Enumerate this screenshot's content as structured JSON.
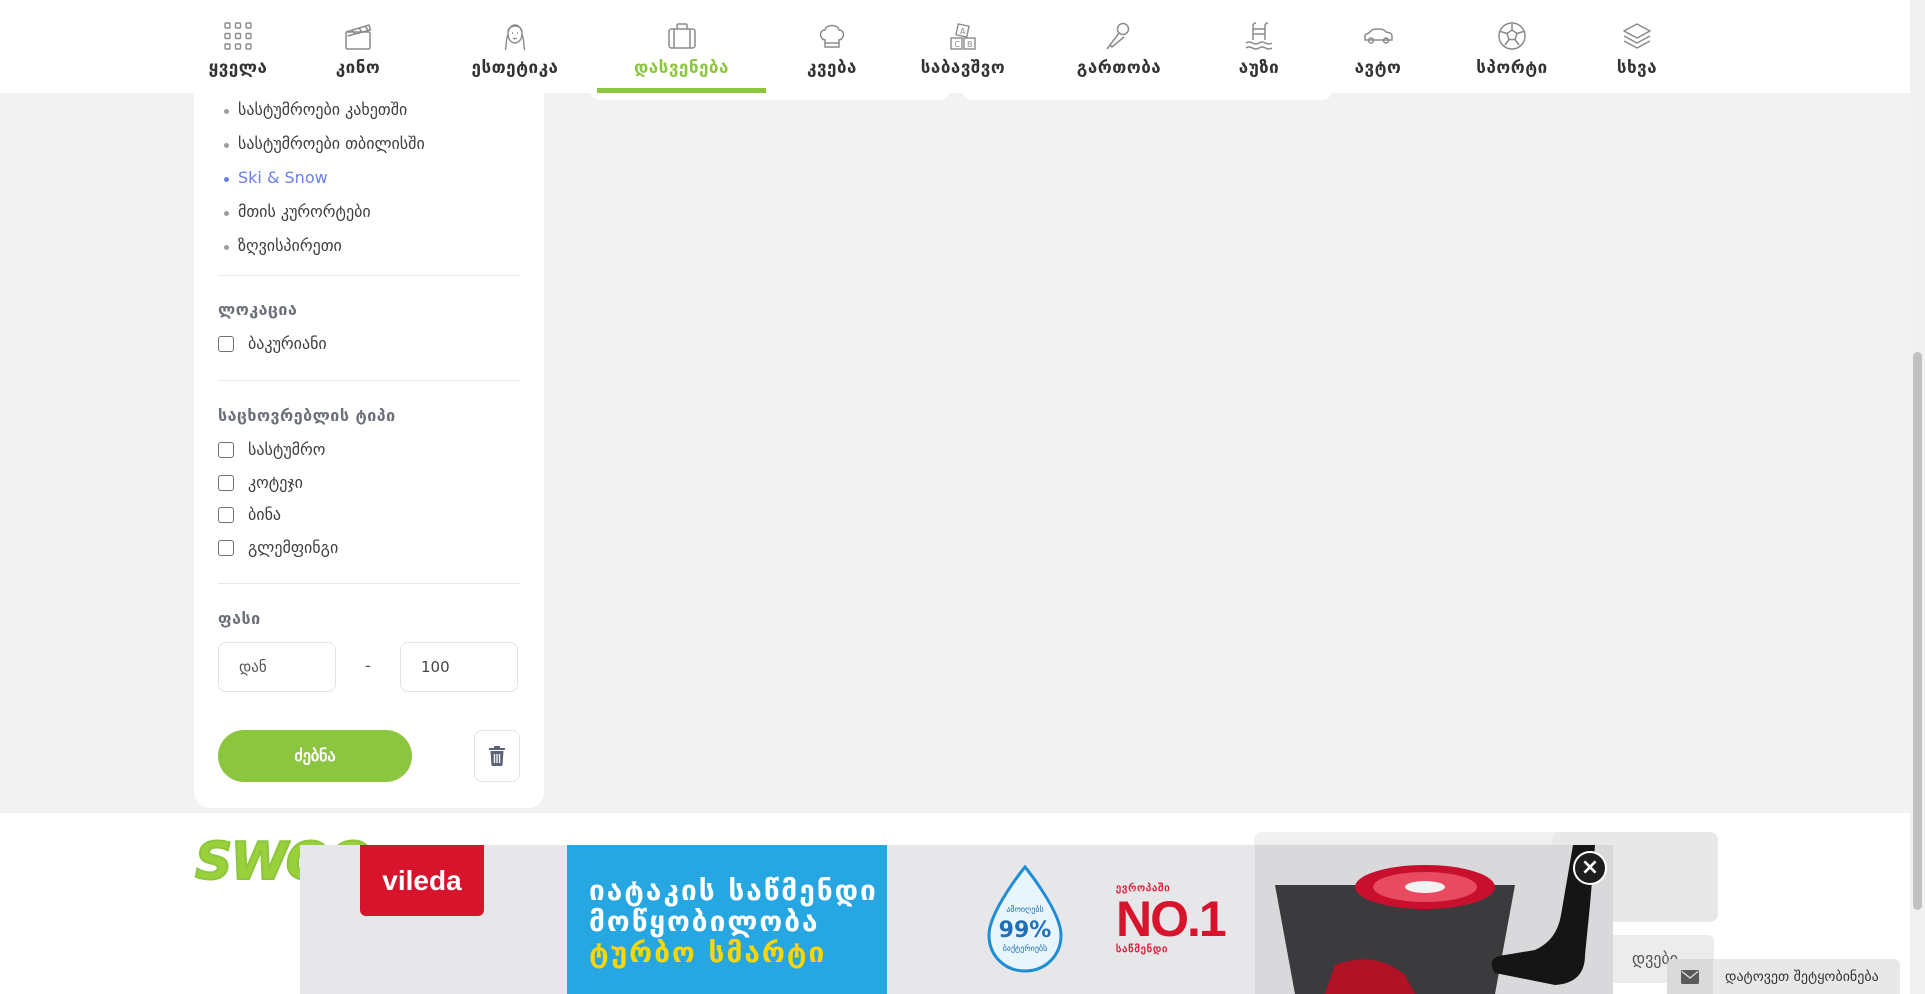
{
  "nav": {
    "categories": [
      {
        "label": "ყველა",
        "icon": "grid-icon"
      },
      {
        "label": "კინო",
        "icon": "clapperboard-icon"
      },
      {
        "label": "ესთეტიკა",
        "icon": "woman-face-icon"
      },
      {
        "label": "დასვენება",
        "icon": "suitcase-icon"
      },
      {
        "label": "კვება",
        "icon": "chef-hat-icon"
      },
      {
        "label": "საბავშვო",
        "icon": "toy-blocks-icon"
      },
      {
        "label": "გართობა",
        "icon": "microphone-icon"
      },
      {
        "label": "აუზი",
        "icon": "pool-ladder-icon"
      },
      {
        "label": "ავტო",
        "icon": "car-icon"
      },
      {
        "label": "სპორტი",
        "icon": "football-icon"
      },
      {
        "label": "სხვა",
        "icon": "layers-icon"
      }
    ],
    "active_index": 3,
    "accent_color": "#8cc63f"
  },
  "sidebar": {
    "links": [
      {
        "label": "სასტუმროები კახეთში",
        "highlighted": false
      },
      {
        "label": "სასტუმროები თბილისში",
        "highlighted": false
      },
      {
        "label": "Ski & Snow",
        "highlighted": true
      },
      {
        "label": "მთის კურორტები",
        "highlighted": false
      },
      {
        "label": "ზღვისპირეთი",
        "highlighted": false
      }
    ],
    "location": {
      "title": "ლოკაცია",
      "options": [
        {
          "label": "ბაკურიანი",
          "checked": false
        }
      ]
    },
    "accommodation": {
      "title": "საცხოვრებლის ტიპი",
      "options": [
        {
          "label": "სასტუმრო",
          "checked": false
        },
        {
          "label": "კოტეჯი",
          "checked": false
        },
        {
          "label": "ბინა",
          "checked": false
        },
        {
          "label": "გლემფინგი",
          "checked": false
        }
      ]
    },
    "price": {
      "title": "ფასი",
      "from_placeholder": "დან",
      "to_value": "100",
      "separator": "-"
    },
    "search_label": "ძებნა",
    "link_highlight_color": "#6b7fe8"
  },
  "footer": {
    "logo_text": "SWOO",
    "button_partial": "დვები"
  },
  "ad": {
    "brand": "vileda",
    "headline": [
      "იატაკის საწმენდი",
      "მოწყობილობა"
    ],
    "product": "ტურბო სმარტი",
    "badge_top": "ამოიღებს",
    "badge_value": "99%",
    "badge_bottom": "ბაქტერიებს",
    "no1_top": "ევროპაში",
    "no1_value": "NO.1",
    "no1_bottom": "საწმენდი",
    "close_symbol": "×"
  },
  "message_bar": {
    "label": "დატოვეთ შეტყობინება",
    "icon": "envelope-icon"
  }
}
